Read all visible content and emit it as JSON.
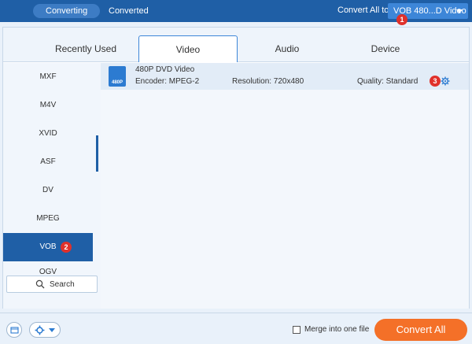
{
  "top_tabs": {
    "converting": "Converting",
    "converted": "Converted"
  },
  "convert_all": {
    "label": "Convert All to:",
    "value": "VOB 480...D Video"
  },
  "badges": {
    "one": "1",
    "two": "2",
    "three": "3"
  },
  "format_tabs": [
    "Recently Used",
    "Video",
    "Audio",
    "Device"
  ],
  "sidebar": {
    "items": [
      "MXF",
      "M4V",
      "XVID",
      "ASF",
      "DV",
      "MPEG",
      "VOB",
      "OGV"
    ],
    "search_label": "Search"
  },
  "profile": {
    "icon_text": "480P",
    "name": "480P DVD Video",
    "encoder": "Encoder: MPEG-2",
    "resolution": "Resolution: 720x480",
    "quality": "Quality: Standard"
  },
  "bottom": {
    "merge_label": "Merge into one file",
    "convert_button": "Convert All"
  },
  "colors": {
    "accent": "#1f5fa6",
    "convert": "#f47028",
    "badge": "#e0312b"
  }
}
